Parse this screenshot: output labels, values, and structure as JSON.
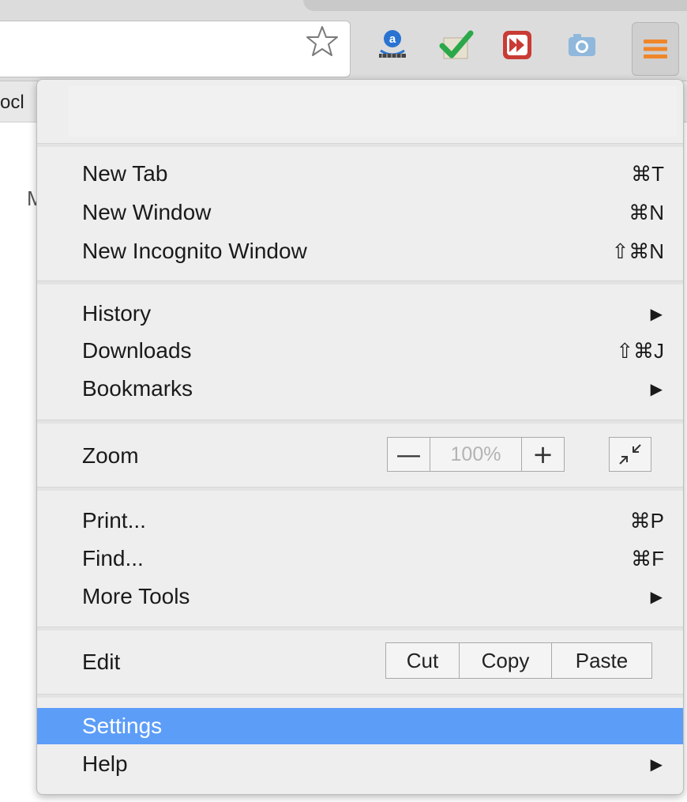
{
  "toolbar": {
    "bookmark_bar_fragment": "ocl",
    "page_fragment": "M",
    "extensions": [
      "amazon-extension-icon",
      "checkmark-extension-icon",
      "fast-forward-extension-icon",
      "camera-extension-icon"
    ],
    "menu_icon": "hamburger-menu-icon",
    "colors": {
      "menu_icon": "#f0862a",
      "checkmark": "#2ba84a",
      "forward": "#c93b35",
      "camera": "#8fb8dc",
      "amazon": "#2a73d1"
    }
  },
  "menu": {
    "new_tab": {
      "label": "New Tab",
      "shortcut": "⌘T"
    },
    "new_window": {
      "label": "New Window",
      "shortcut": "⌘N"
    },
    "new_incognito": {
      "label": "New Incognito Window",
      "shortcut": "⇧⌘N"
    },
    "history": {
      "label": "History",
      "arrow": "▶"
    },
    "downloads": {
      "label": "Downloads",
      "shortcut": "⇧⌘J"
    },
    "bookmarks": {
      "label": "Bookmarks",
      "arrow": "▶"
    },
    "zoom": {
      "label": "Zoom",
      "minus": "—",
      "level": "100%",
      "plus": "+"
    },
    "print": {
      "label": "Print...",
      "shortcut": "⌘P"
    },
    "find": {
      "label": "Find...",
      "shortcut": "⌘F"
    },
    "more_tools": {
      "label": "More Tools",
      "arrow": "▶"
    },
    "edit": {
      "label": "Edit",
      "cut": "Cut",
      "copy": "Copy",
      "paste": "Paste"
    },
    "settings": {
      "label": "Settings"
    },
    "help": {
      "label": "Help",
      "arrow": "▶"
    },
    "highlight_color": "#5c9df8"
  }
}
